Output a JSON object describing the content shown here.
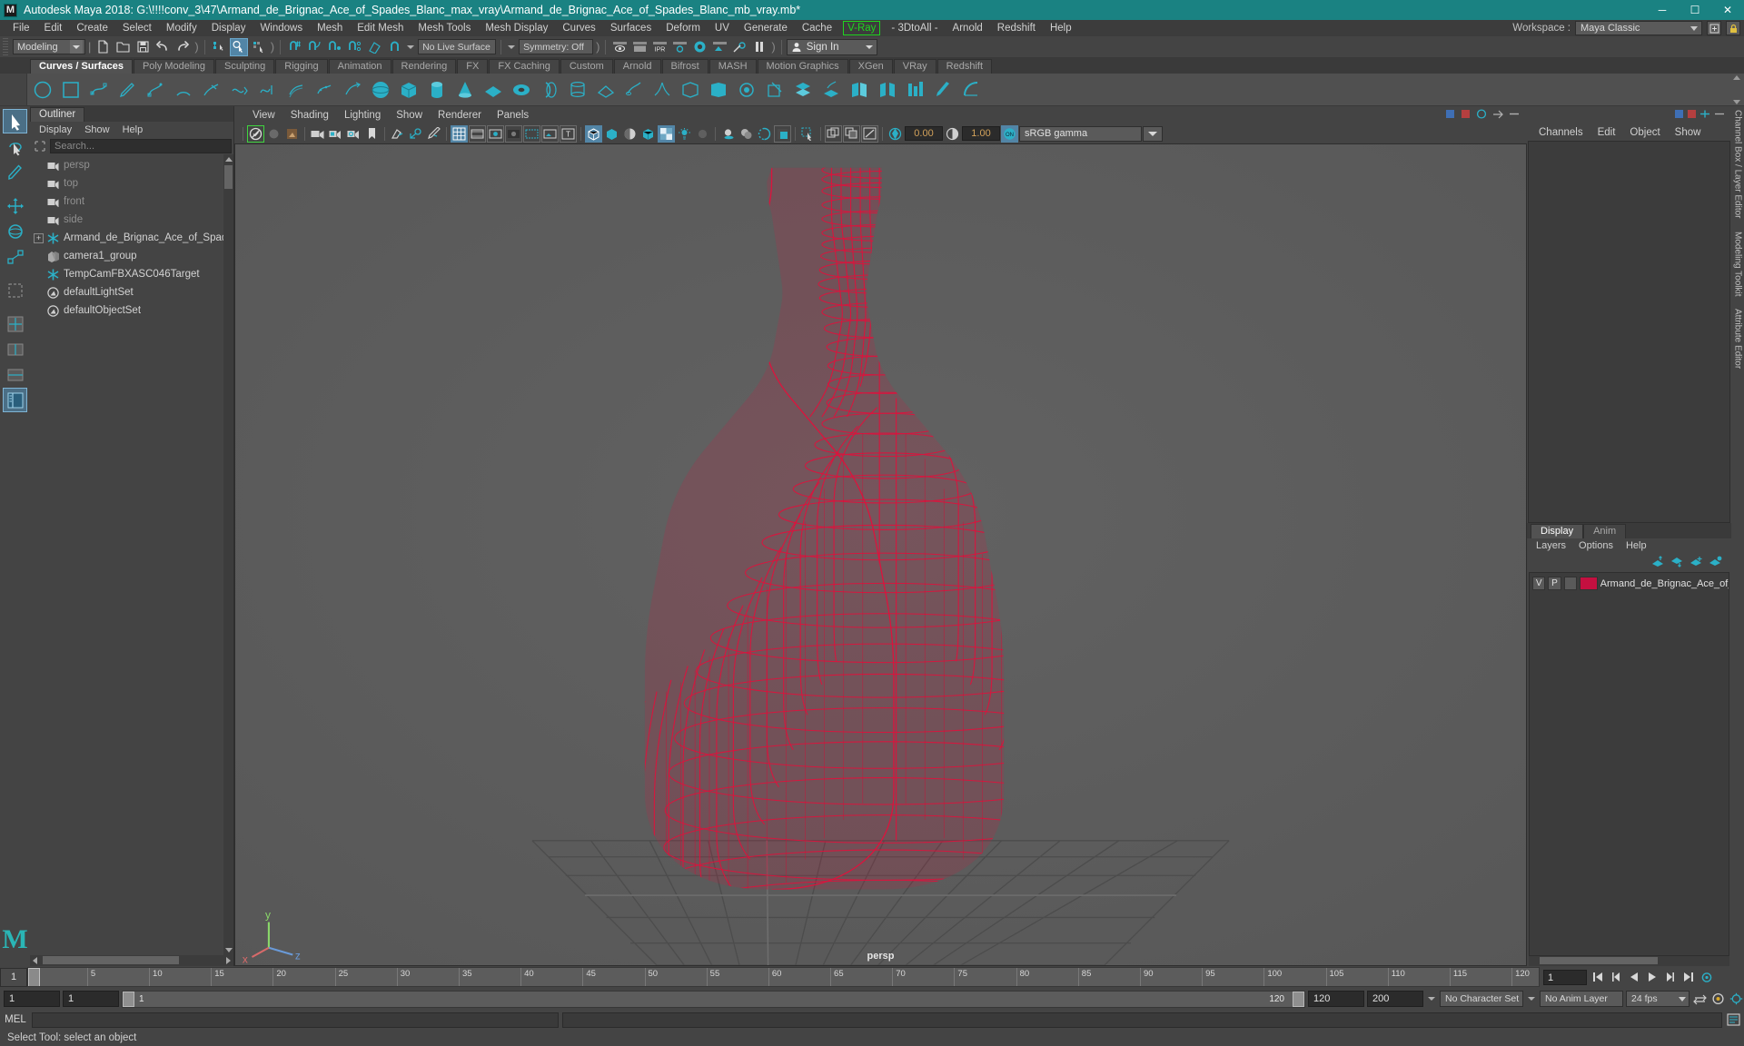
{
  "window": {
    "title": "Autodesk Maya 2018: G:\\!!!!conv_3\\47\\Armand_de_Brignac_Ace_of_Spades_Blanc_max_vray\\Armand_de_Brignac_Ace_of_Spades_Blanc_mb_vray.mb*",
    "app_icon": "M",
    "minimize": "─",
    "maximize": "☐",
    "close": "✕"
  },
  "menubar": {
    "items": [
      "File",
      "Edit",
      "Create",
      "Select",
      "Modify",
      "Display",
      "Windows",
      "Mesh",
      "Edit Mesh",
      "Mesh Tools",
      "Mesh Display",
      "Curves",
      "Surfaces",
      "Deform",
      "UV",
      "Generate",
      "Cache"
    ],
    "vray": "V-Ray",
    "after_vray": [
      "- 3DtoAll -",
      "Arnold",
      "Redshift",
      "Help"
    ],
    "workspace_label": "Workspace :",
    "workspace_value": "Maya Classic"
  },
  "statusline": {
    "mode": "Modeling",
    "live_surface": "No Live Surface",
    "symmetry": "Symmetry: Off",
    "signin": "Sign In"
  },
  "shelf": {
    "tabs": [
      "Curves / Surfaces",
      "Poly Modeling",
      "Sculpting",
      "Rigging",
      "Animation",
      "Rendering",
      "FX",
      "FX Caching",
      "Custom",
      "Arnold",
      "Bifrost",
      "MASH",
      "Motion Graphics",
      "XGen",
      "VRay",
      "Redshift"
    ],
    "active_tab": "Curves / Surfaces"
  },
  "outliner": {
    "tab": "Outliner",
    "menus": [
      "Display",
      "Show",
      "Help"
    ],
    "search_placeholder": "Search...",
    "items": [
      {
        "label": "persp",
        "icon": "camera-icon",
        "indent": 1,
        "dim": true,
        "expander": false
      },
      {
        "label": "top",
        "icon": "camera-icon",
        "indent": 1,
        "dim": true,
        "expander": false
      },
      {
        "label": "front",
        "icon": "camera-icon",
        "indent": 1,
        "dim": true,
        "expander": false
      },
      {
        "label": "side",
        "icon": "camera-icon",
        "indent": 1,
        "dim": true,
        "expander": false
      },
      {
        "label": "Armand_de_Brignac_Ace_of_Spades_B",
        "icon": "transform-icon",
        "indent": 0,
        "dim": false,
        "expander": true
      },
      {
        "label": "camera1_group",
        "icon": "group-icon",
        "indent": 1,
        "dim": false,
        "expander": false
      },
      {
        "label": "TempCamFBXASC046Target",
        "icon": "transform-icon",
        "indent": 1,
        "dim": false,
        "expander": false
      },
      {
        "label": "defaultLightSet",
        "icon": "set-icon",
        "indent": 1,
        "dim": false,
        "expander": false
      },
      {
        "label": "defaultObjectSet",
        "icon": "set-icon",
        "indent": 1,
        "dim": false,
        "expander": false
      }
    ]
  },
  "viewport": {
    "menus": [
      "View",
      "Shading",
      "Lighting",
      "Show",
      "Renderer",
      "Panels"
    ],
    "exposure": "0.00",
    "gamma_value": "1.00",
    "color_profile": "sRGB gamma",
    "camera_label": "persp",
    "axis": {
      "x": "x",
      "y": "y",
      "z": "z"
    },
    "wire_color": "#e0113c",
    "bg_color": "#5b5b5b",
    "grid_color": "#4b4b4b"
  },
  "channelbox": {
    "menus": [
      "Channels",
      "Edit",
      "Object",
      "Show"
    ],
    "side_labels": [
      "Channel Box / Layer Editor",
      "Modeling Toolkit",
      "Attribute Editor"
    ]
  },
  "layer_editor": {
    "tabs": [
      "Display",
      "Anim"
    ],
    "active_tab": "Display",
    "menus": [
      "Layers",
      "Options",
      "Help"
    ],
    "layers": [
      {
        "visibility": "V",
        "playback": "P",
        "color": "#c41040",
        "name": "Armand_de_Brignac_Ace_of_Sp"
      }
    ]
  },
  "timeline": {
    "current_frame_left": "1",
    "ticks": [
      {
        "label": "5",
        "pos": 5
      },
      {
        "label": "10",
        "pos": 10
      },
      {
        "label": "15",
        "pos": 15
      },
      {
        "label": "20",
        "pos": 20
      },
      {
        "label": "25",
        "pos": 25
      },
      {
        "label": "30",
        "pos": 30
      },
      {
        "label": "35",
        "pos": 35
      },
      {
        "label": "40",
        "pos": 40
      },
      {
        "label": "45",
        "pos": 45
      },
      {
        "label": "50",
        "pos": 50
      },
      {
        "label": "55",
        "pos": 55
      },
      {
        "label": "60",
        "pos": 60
      },
      {
        "label": "65",
        "pos": 65
      },
      {
        "label": "70",
        "pos": 70
      },
      {
        "label": "75",
        "pos": 75
      },
      {
        "label": "80",
        "pos": 80
      },
      {
        "label": "85",
        "pos": 85
      },
      {
        "label": "90",
        "pos": 90
      },
      {
        "label": "95",
        "pos": 95
      },
      {
        "label": "100",
        "pos": 100
      },
      {
        "label": "105",
        "pos": 105
      },
      {
        "label": "110",
        "pos": 110
      },
      {
        "label": "115",
        "pos": 115
      },
      {
        "label": "120",
        "pos": 120
      }
    ],
    "frame_field": "1",
    "range_start": "1",
    "range_start2": "1",
    "range_slider_start": "1",
    "range_slider_end": "120",
    "range_end": "120",
    "range_end_total": "200",
    "character_set": "No Character Set",
    "anim_layer": "No Anim Layer",
    "fps": "24 fps"
  },
  "mel": {
    "label": "MEL",
    "input_value": "",
    "output_value": ""
  },
  "statusbar": {
    "message": "Select Tool: select an object"
  },
  "colors": {
    "title_bg": "#1a8282",
    "panel_bg": "#444444",
    "accent": "#5285a6",
    "icon_teal": "#2bb0c7",
    "vray_green": "#1fd41f"
  }
}
